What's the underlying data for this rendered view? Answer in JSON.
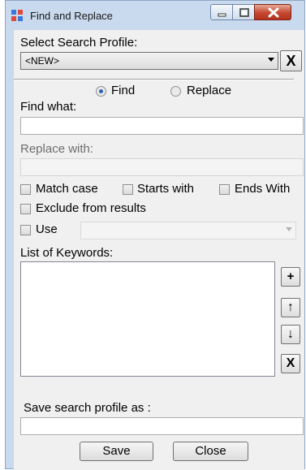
{
  "window": {
    "title": "Find and Replace",
    "icon": "find-replace-app-icon",
    "buttons": {
      "minimize": "minimize-icon",
      "maximize": "maximize-icon",
      "close": "close-icon"
    }
  },
  "profile": {
    "label": "Select Search Profile:",
    "selected": "<NEW>",
    "delete_glyph": "X"
  },
  "mode": {
    "find_label": "Find",
    "replace_label": "Replace",
    "selected": "Find"
  },
  "find_what": {
    "label": "Find what:",
    "value": ""
  },
  "replace_with": {
    "label": "Replace with:",
    "value": ""
  },
  "options": {
    "match_case": {
      "label": "Match case",
      "checked": false
    },
    "starts_with": {
      "label": "Starts with",
      "checked": false
    },
    "ends_with": {
      "label": "Ends With",
      "checked": false
    },
    "exclude": {
      "label": "Exclude from results",
      "checked": false
    },
    "use": {
      "label": "Use",
      "checked": false,
      "value": ""
    }
  },
  "keywords": {
    "label": "List of Keywords:",
    "items": [],
    "buttons": {
      "add": "+",
      "up": "↑",
      "down": "↓",
      "remove": "X"
    }
  },
  "save_profile": {
    "label": "Save search profile as :",
    "value": ""
  },
  "footer": {
    "save_label": "Save",
    "close_label": "Close"
  },
  "colors": {
    "frame": "#c9d9ee",
    "client": "#f0f0f0",
    "close_button": "#c4472f",
    "radio_dot": "#2a62b8"
  }
}
